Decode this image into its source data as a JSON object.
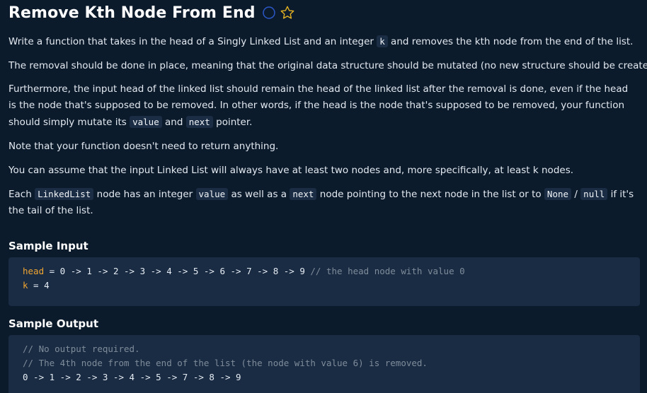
{
  "title": "Remove Kth Node From End",
  "icons": {
    "status": "circle-outline-icon",
    "favorite": "star-outline-icon",
    "status_color": "#2b58c8",
    "favorite_color": "#e6b422"
  },
  "description": {
    "p1": {
      "a": "Write a function that takes in the head of a Singly Linked List and an integer ",
      "code1": "k",
      "b": " and removes the kth node from the end of the list."
    },
    "p2": "The removal should be done in place, meaning that the original data structure should be mutated (no new structure should be created).",
    "p3": {
      "a": "Furthermore, the input head of the linked list should remain the head of the linked list after the removal is done, even if the head is the node that's supposed to be removed. In other words, if the head is the node that's supposed to be removed, your function should simply mutate its ",
      "code1": "value",
      "b": " and ",
      "code2": "next",
      "c": " pointer."
    },
    "p4": "Note that your function doesn't need to return anything.",
    "p5": "You can assume that the input Linked List will always have at least two nodes and, more specifically, at least k nodes.",
    "p6": {
      "a": "Each ",
      "code1": "LinkedList",
      "b": " node has an integer ",
      "code2": "value",
      "c": " as well as a ",
      "code3": "next",
      "d": " node pointing to the next node in the list or to ",
      "code4": "None",
      "e": " / ",
      "code5": "null",
      "f": " if it's the tail of the list."
    }
  },
  "sample_input": {
    "heading": "Sample Input",
    "line1_kw": "head",
    "line1_code": " = 0 -> 1 -> 2 -> 3 -> 4 -> 5 -> 6 -> 7 -> 8 -> 9 ",
    "line1_comment": "// the head node with value 0",
    "line2_kw": "k",
    "line2_code": " = 4"
  },
  "sample_output": {
    "heading": "Sample Output",
    "line1_comment": "// No output required.",
    "line2_comment": "// The 4th node from the end of the list (the node with value 6) is removed.",
    "line3_code": "0 -> 1 -> 2 -> 3 -> 4 -> 5 -> 7 -> 8 -> 9"
  }
}
